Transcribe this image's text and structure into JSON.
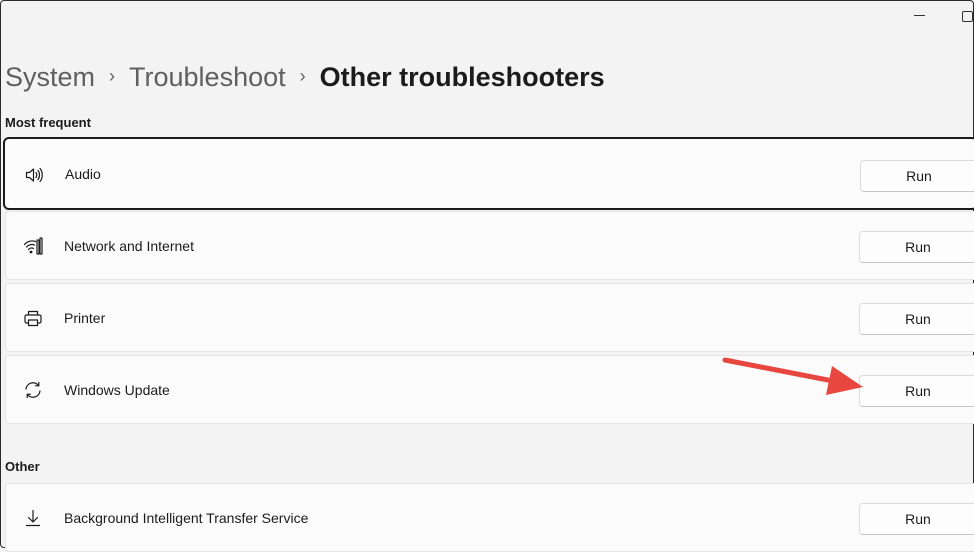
{
  "breadcrumb": {
    "items": [
      "System",
      "Troubleshoot"
    ],
    "current": "Other troubleshooters",
    "separator": "›"
  },
  "sections": {
    "most_frequent": {
      "label": "Most frequent",
      "items": [
        {
          "label": "Audio",
          "icon": "speaker-icon",
          "button": "Run"
        },
        {
          "label": "Network and Internet",
          "icon": "network-icon",
          "button": "Run"
        },
        {
          "label": "Printer",
          "icon": "printer-icon",
          "button": "Run"
        },
        {
          "label": "Windows Update",
          "icon": "sync-icon",
          "button": "Run"
        }
      ]
    },
    "other": {
      "label": "Other",
      "items": [
        {
          "label": "Background Intelligent Transfer Service",
          "icon": "download-icon",
          "button": "Run"
        }
      ]
    }
  },
  "colors": {
    "annotation_arrow": "#e8473f",
    "background": "#f3f3f3",
    "card": "#fbfbfb"
  }
}
